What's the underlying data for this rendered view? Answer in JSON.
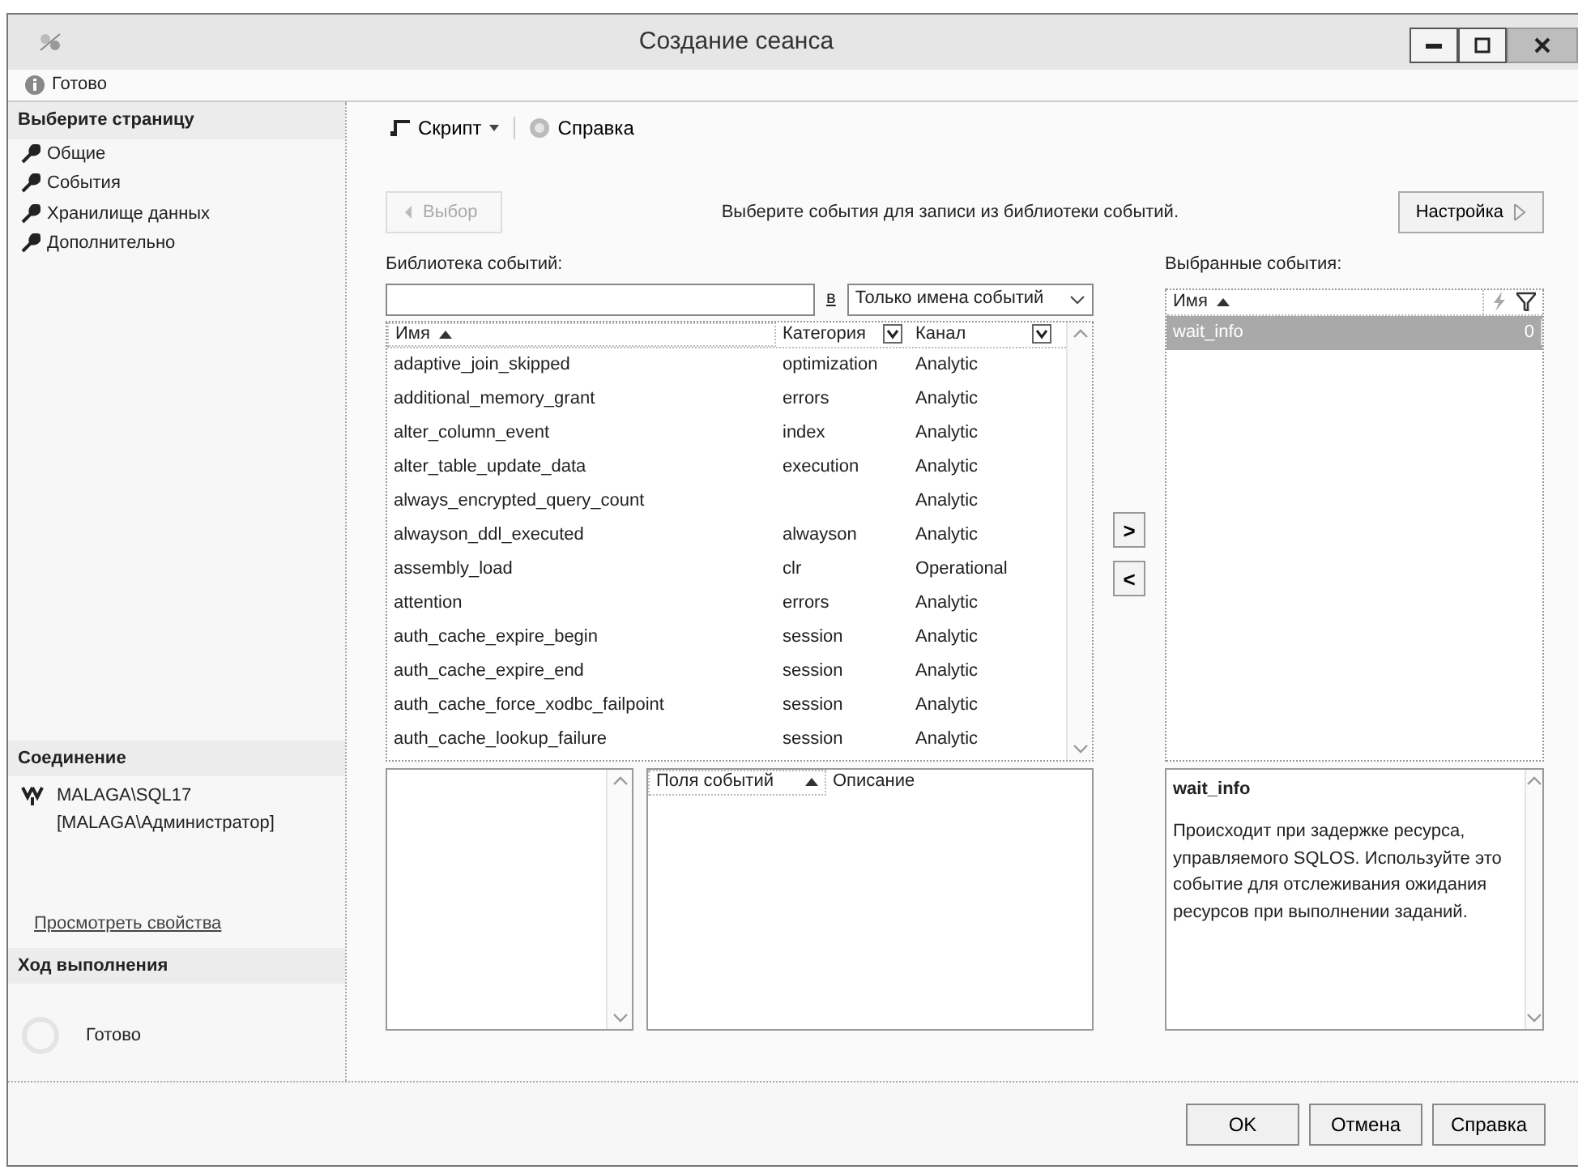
{
  "window": {
    "title": "Создание сеанса"
  },
  "status": {
    "text": "Готово"
  },
  "sidebar": {
    "heading": "Выберите страницу",
    "pages": [
      {
        "label": "Общие"
      },
      {
        "label": "События"
      },
      {
        "label": "Хранилище данных"
      },
      {
        "label": "Дополнительно"
      }
    ],
    "connection": {
      "heading": "Соединение",
      "server": "MALAGA\\SQL17",
      "user": "[MALAGA\\Администратор]",
      "link": "Просмотреть свойства"
    },
    "progress": {
      "heading": "Ход выполнения",
      "text": "Готово"
    }
  },
  "toolbar": [
    {
      "kind": "script",
      "label": "Скрипт"
    },
    {
      "kind": "help",
      "label": "Справка"
    }
  ],
  "wizard": {
    "back_button": {
      "label": "Выбор",
      "disabled": true
    },
    "instruction": "Выберите события для записи из библиотеки событий.",
    "next_button": {
      "label": "Настройка",
      "disabled": false
    }
  },
  "library": {
    "label": "Библиотека событий:",
    "scope_label": "в",
    "scope": "Только имена событий",
    "columns": [
      "Имя",
      "Категория",
      "Канал"
    ],
    "rows": [
      {
        "name": "adaptive_join_skipped",
        "category": "optimization",
        "channel": "Analytic"
      },
      {
        "name": "additional_memory_grant",
        "category": "errors",
        "channel": "Analytic"
      },
      {
        "name": "alter_column_event",
        "category": "index",
        "channel": "Analytic"
      },
      {
        "name": "alter_table_update_data",
        "category": "execution",
        "channel": "Analytic"
      },
      {
        "name": "always_encrypted_query_count",
        "channel": "Analytic"
      },
      {
        "name": "alwayson_ddl_executed",
        "category": "alwayson",
        "channel": "Analytic"
      },
      {
        "name": "assembly_load",
        "category": "clr",
        "channel": "Operational"
      },
      {
        "name": "attention",
        "category": "errors",
        "channel": "Analytic"
      },
      {
        "name": "auth_cache_expire_begin",
        "category": "session",
        "channel": "Analytic"
      },
      {
        "name": "auth_cache_expire_end",
        "category": "session",
        "channel": "Analytic"
      },
      {
        "name": "auth_cache_force_xodbc_failpoint",
        "category": "session",
        "channel": "Analytic"
      },
      {
        "name": "auth_cache_lookup_failure",
        "category": "session",
        "channel": "Analytic"
      }
    ]
  },
  "transfer_buttons": [
    ">",
    "<"
  ],
  "selected_events": {
    "label": "Выбранные события:",
    "columns": [
      "Имя"
    ],
    "rows": [
      {
        "name": "wait_info",
        "count": "0",
        "selected": true
      }
    ]
  },
  "fields_pane": {
    "columns": [
      "Поля событий",
      "Описание"
    ]
  },
  "description": {
    "title": "wait_info",
    "text": "Происходит при задержке ресурса, управляемого SQLOS. Используйте это событие для отслеживания ожидания ресурсов при выполнении заданий."
  },
  "footer_buttons": [
    "OK",
    "Отмена",
    "Справка"
  ]
}
